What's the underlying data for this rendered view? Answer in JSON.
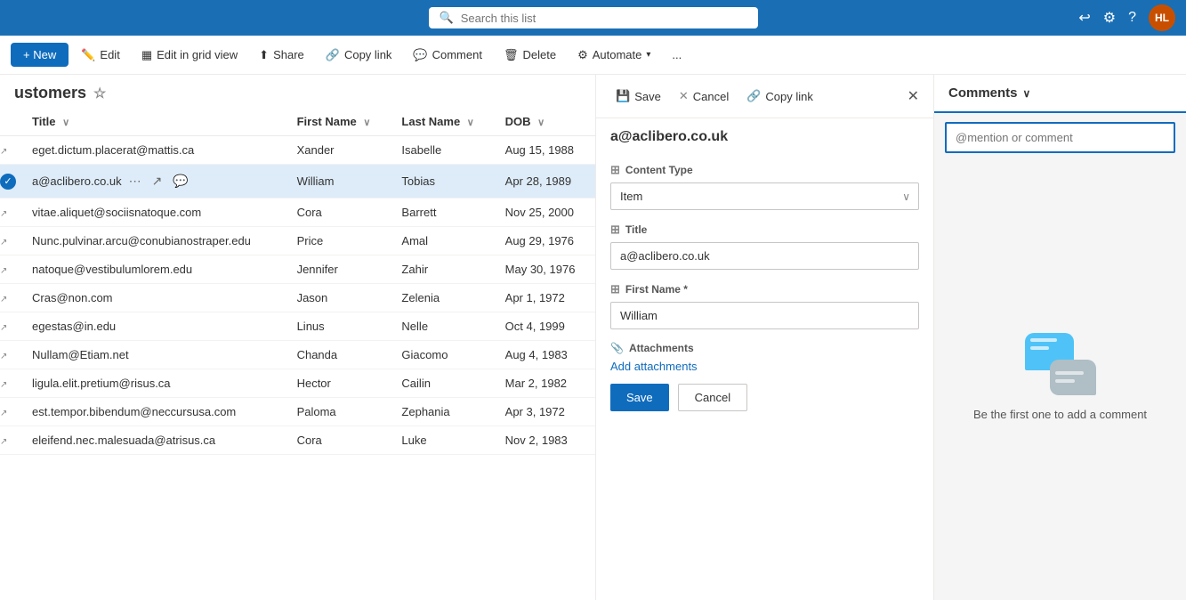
{
  "topbar": {
    "search_placeholder": "Search this list",
    "avatar_label": "HL"
  },
  "commandbar": {
    "new_label": "+ New",
    "edit_label": "Edit",
    "edit_grid_label": "Edit in grid view",
    "share_label": "Share",
    "copy_link_label": "Copy link",
    "comment_label": "Comment",
    "delete_label": "Delete",
    "automate_label": "Automate",
    "more_label": "..."
  },
  "list": {
    "title": "ustomers",
    "columns": [
      {
        "label": "Title"
      },
      {
        "label": "First Name"
      },
      {
        "label": "Last Name"
      },
      {
        "label": "DOB"
      }
    ],
    "rows": [
      {
        "title": "eget.dictum.placerat@mattis.ca",
        "first_name": "Xander",
        "last_name": "Isabelle",
        "dob": "Aug 15, 1988",
        "selected": false
      },
      {
        "title": "a@aclibero.co.uk",
        "first_name": "William",
        "last_name": "Tobias",
        "dob": "Apr 28, 1989",
        "selected": true
      },
      {
        "title": "vitae.aliquet@sociisnatoque.com",
        "first_name": "Cora",
        "last_name": "Barrett",
        "dob": "Nov 25, 2000",
        "selected": false
      },
      {
        "title": "Nunc.pulvinar.arcu@conubianostraper.edu",
        "first_name": "Price",
        "last_name": "Amal",
        "dob": "Aug 29, 1976",
        "selected": false
      },
      {
        "title": "natoque@vestibulumlorem.edu",
        "first_name": "Jennifer",
        "last_name": "Zahir",
        "dob": "May 30, 1976",
        "selected": false
      },
      {
        "title": "Cras@non.com",
        "first_name": "Jason",
        "last_name": "Zelenia",
        "dob": "Apr 1, 1972",
        "selected": false
      },
      {
        "title": "egestas@in.edu",
        "first_name": "Linus",
        "last_name": "Nelle",
        "dob": "Oct 4, 1999",
        "selected": false
      },
      {
        "title": "Nullam@Etiam.net",
        "first_name": "Chanda",
        "last_name": "Giacomo",
        "dob": "Aug 4, 1983",
        "selected": false
      },
      {
        "title": "ligula.elit.pretium@risus.ca",
        "first_name": "Hector",
        "last_name": "Cailin",
        "dob": "Mar 2, 1982",
        "selected": false
      },
      {
        "title": "est.tempor.bibendum@neccursusa.com",
        "first_name": "Paloma",
        "last_name": "Zephania",
        "dob": "Apr 3, 1972",
        "selected": false
      },
      {
        "title": "eleifend.nec.malesuada@atrisus.ca",
        "first_name": "Cora",
        "last_name": "Luke",
        "dob": "Nov 2, 1983",
        "selected": false
      }
    ]
  },
  "form": {
    "save_label": "Save",
    "cancel_top_label": "Cancel",
    "copy_link_label": "Copy link",
    "title_text": "a@aclibero.co.uk",
    "content_type_label": "Content Type",
    "content_type_value": "Item",
    "title_field_label": "Title",
    "title_field_value": "a@aclibero.co.uk",
    "first_name_label": "First Name *",
    "first_name_value": "William",
    "attachments_label": "Attachments",
    "add_attachments_label": "Add attachments",
    "save_btn_label": "Save",
    "cancel_btn_label": "Cancel"
  },
  "comments": {
    "title": "Comments",
    "chevron": "∨",
    "input_placeholder": "@mention or comment",
    "empty_text": "Be the first one to add a comment"
  }
}
